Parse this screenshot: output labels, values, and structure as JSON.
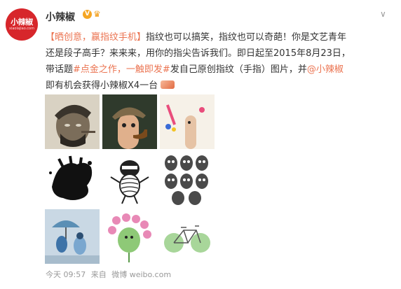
{
  "post": {
    "username": "小辣椒",
    "verified_label": "V",
    "avatar": {
      "logo_text": "小辣椒",
      "logo_sub": "xiaolajiao.com"
    },
    "text": {
      "topic": "【晒创意，赢指纹手机】",
      "part1": "指纹也可以搞笑，指纹也可以奇葩！你是文艺青年还是段子高手？来来来，用你的指尖告诉我们。即日起至2015年8月23日，带话题",
      "hashtag": "#点金之作，一触即发#",
      "part2": "发自己原创指纹（手指）图片，并",
      "mention": "@小辣椒",
      "part3": " 即有机会获得小辣椒X4一台"
    },
    "meta": {
      "time": "今天 09:57",
      "source": "来自",
      "watermark": "微博 weibo.com"
    }
  },
  "images": [
    {
      "name": "che-guevara-fingerprint"
    },
    {
      "name": "detective-finger-with-pipe"
    },
    {
      "name": "finger-figure-with-pink-crayon"
    },
    {
      "name": "black-hand-splash"
    },
    {
      "name": "fingerprint-ninja-figure"
    },
    {
      "name": "fingerprint-faces-grid"
    },
    {
      "name": "umbrella-couple-sketch"
    },
    {
      "name": "fingerprint-flower-figure"
    },
    {
      "name": "fingerprint-bicycle"
    }
  ],
  "colors": {
    "accent": "#eb7350",
    "brand_red": "#d7262b",
    "muted_text": "#999999"
  }
}
